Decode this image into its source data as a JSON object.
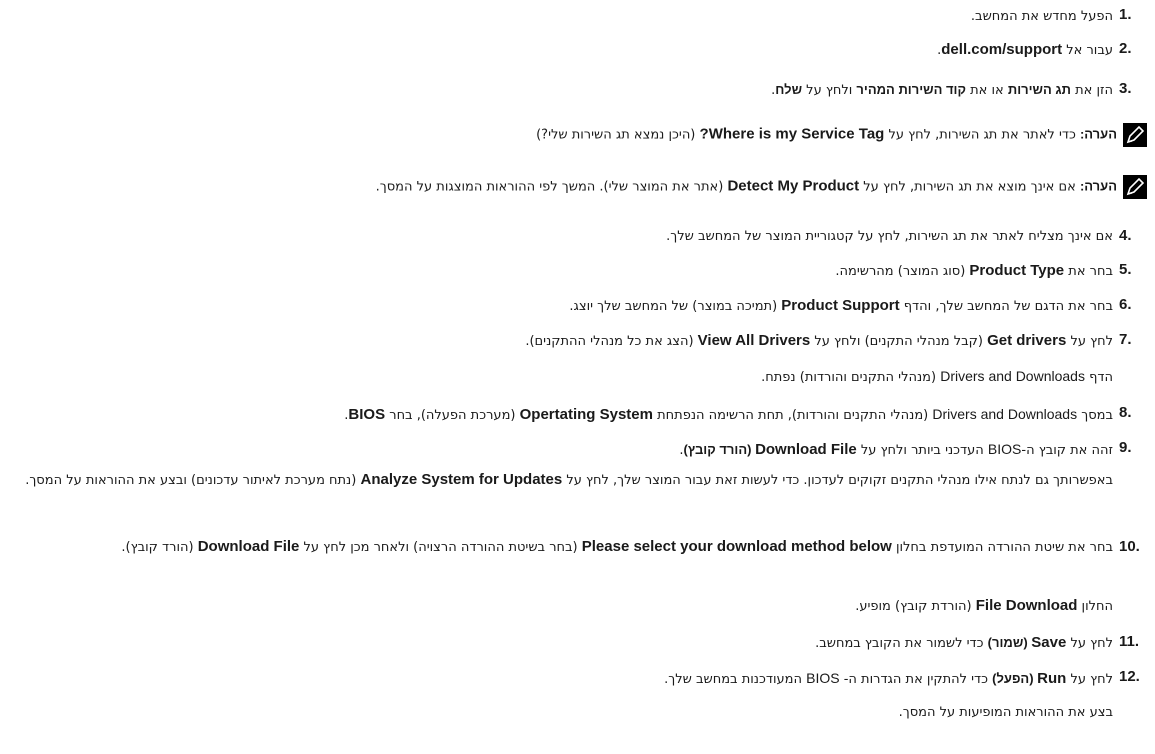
{
  "steps": {
    "s1": {
      "num": "1.",
      "text": "הפעל מחדש את המחשב."
    },
    "s2": {
      "num": "2.",
      "pre": "עבור אל ",
      "bold": "dell.com/support",
      "post": "."
    },
    "s3": {
      "num": "3.",
      "a": "הזן את ",
      "b1": "תג השירות",
      "c": " או את ",
      "b2": "קוד השירות המהיר",
      "d": " ולחץ על ",
      "b3": "שלח",
      "e": "."
    },
    "note1": {
      "label": "הערה:",
      "a": " כדי לאתר את תג השירות, לחץ על ",
      "bold": "Where is my Service Tag?",
      "b": " (היכן נמצא תג השירות שלי?)"
    },
    "note2": {
      "label": "הערה:",
      "a": " אם אינך מוצא את תג השירות, לחץ על ",
      "bold": "Detect My Product",
      "b": " (אתר את המוצר שלי). המשך לפי ההוראות המוצגות על המסך."
    },
    "s4": {
      "num": "4.",
      "text": "אם אינך מצליח לאתר את תג השירות, לחץ על קטגוריית המוצר של המחשב שלך."
    },
    "s5": {
      "num": "5.",
      "a": "בחר את ",
      "bold": "Product Type",
      "b": " (סוג המוצר) מהרשימה."
    },
    "s6": {
      "num": "6.",
      "a": "בחר את הדגם של המחשב שלך, והדף ",
      "bold": "Product Support",
      "b": " (תמיכה במוצר) של המחשב שלך יוצג."
    },
    "s7": {
      "num": "7.",
      "a": "לחץ על ",
      "b1": "Get drivers",
      "c": " (קבל מנהלי התקנים) ולחץ על ",
      "b2": "View All Drivers",
      "d": " (הצג את כל מנהלי ההתקנים)."
    },
    "s7sub": {
      "a": "הדף ",
      "lat": "Drivers and Downloads",
      "b": " (מנהלי התקנים והורדות) נפתח."
    },
    "s8": {
      "num": "8.",
      "a": "במסך ",
      "lat": "Drivers and Downloads",
      "b": " (מנהלי התקנים והורדות), תחת הרשימה הנפתחת ",
      "b1": "Opertating System",
      "c": " (מערכת הפעלה), בחר ",
      "b2": "BIOS",
      "d": "."
    },
    "s9": {
      "num": "9.",
      "a": "זהה את קובץ ה-",
      "lat": "BIOS",
      "b": " העדכני ביותר ולחץ על ",
      "b1": "Download File",
      "b2": " (הורד קובץ)",
      "c": "."
    },
    "s9sub": {
      "a": "באפשרותך גם לנתח אילו מנהלי התקנים זקוקים לעדכון. כדי לעשות זאת עבור המוצר שלך, לחץ על ",
      "bold": "Analyze System for Updates",
      "b": " (נתח מערכת לאיתור עדכונים) ובצע את ההוראות על המסך."
    },
    "s10": {
      "num": "10.",
      "a": "בחר את שיטת ההורדה המועדפת בחלון ",
      "bold": "Please select your download method below",
      "b": " (בחר בשיטת ההורדה הרצויה) ולאחר מכן לחץ על ",
      "b1": "Download File",
      "c": " (הורד קובץ)."
    },
    "s10sub": {
      "a": "החלון ",
      "bold": "File Download",
      "b": " (הורדת קובץ) מופיע."
    },
    "s11": {
      "num": "11.",
      "a": "לחץ על ",
      "b1": "Save",
      "b2": " (שמור)",
      "c": " כדי לשמור את הקובץ במחשב."
    },
    "s12": {
      "num": "12.",
      "a": "לחץ על ",
      "b1": "Run",
      "b2": " (הפעל)",
      "c": " כדי להתקין את הגדרות ה- ",
      "lat": "BIOS",
      "d": " המעודכנות במחשב שלך."
    },
    "s12sub": {
      "text": "בצע את ההוראות המופיעות על המסך."
    }
  },
  "icons": {
    "note": "pencil-note-icon"
  }
}
